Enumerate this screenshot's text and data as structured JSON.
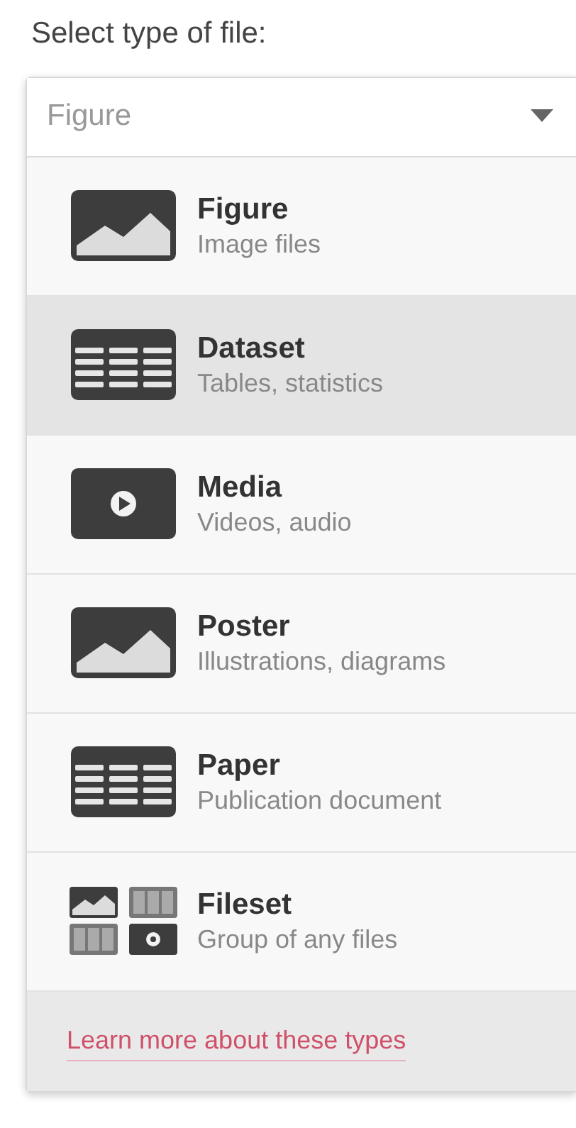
{
  "label": "Select type of file:",
  "select": {
    "value": "Figure"
  },
  "options": [
    {
      "title": "Figure",
      "subtitle": "Image files",
      "kind": "image",
      "selected": false
    },
    {
      "title": "Dataset",
      "subtitle": "Tables, statistics",
      "kind": "table",
      "selected": true
    },
    {
      "title": "Media",
      "subtitle": "Videos, audio",
      "kind": "media",
      "selected": false
    },
    {
      "title": "Poster",
      "subtitle": "Illustrations, diagrams",
      "kind": "image",
      "selected": false
    },
    {
      "title": "Paper",
      "subtitle": "Publication document",
      "kind": "table",
      "selected": false
    },
    {
      "title": "Fileset",
      "subtitle": "Group of any files",
      "kind": "fileset",
      "selected": false
    }
  ],
  "footer_link": "Learn more about these types"
}
